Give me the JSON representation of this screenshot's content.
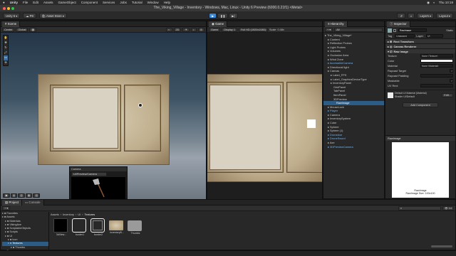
{
  "menubar": {
    "apple": "",
    "items": [
      "Unity",
      "File",
      "Edit",
      "Assets",
      "GameObject",
      "Component",
      "Services",
      "Jobs",
      "Tutorial",
      "Window",
      "Help"
    ],
    "status": [
      "◉",
      "◐",
      "Thu 10:19"
    ]
  },
  "window": {
    "title": "The_Viking_Village - Inventory - Windows, Mac, Linux - Unity 6 Preview (6000.0.21f1) <Metal>"
  },
  "toolbar": {
    "account": "Unity 6",
    "cloud_label": "P8",
    "asset_store": "Asset Store",
    "layers": "Layers",
    "layout": "Layout"
  },
  "scene": {
    "tab": "Scene",
    "tools": [
      "Center",
      "Global"
    ],
    "camera_panel": {
      "title": "Camera",
      "dropdown": "UI/Preview/Camera"
    }
  },
  "game": {
    "tab": "Game",
    "display": "Game",
    "display_select": "Display 1",
    "resolution": "Full HD (1920x1080)",
    "scale_label": "Scale",
    "scale_value": "0.48x",
    "play_focused": "Play Focused"
  },
  "hierarchy": {
    "tab": "Hierarchy",
    "search_placeholder": "All",
    "rows": [
      {
        "label": "The_Viking_Village*",
        "indent": 0,
        "cls": ""
      },
      {
        "label": "Content",
        "indent": 1,
        "cls": ""
      },
      {
        "label": "Reflection Probes",
        "indent": 1,
        "cls": ""
      },
      {
        "label": "Light Probes",
        "indent": 1,
        "cls": ""
      },
      {
        "label": "Volumes",
        "indent": 1,
        "cls": ""
      },
      {
        "label": "Occlusion Area",
        "indent": 1,
        "cls": ""
      },
      {
        "label": "Wind Zone",
        "indent": 1,
        "cls": ""
      },
      {
        "label": "AccessibleCamera",
        "indent": 1,
        "cls": "blue"
      },
      {
        "label": "Directional light",
        "indent": 1,
        "cls": ""
      },
      {
        "label": "Canvas",
        "indent": 1,
        "cls": ""
      },
      {
        "label": "Label_FPS",
        "indent": 2,
        "cls": ""
      },
      {
        "label": "Label_GraphicsDeviceType",
        "indent": 2,
        "cls": ""
      },
      {
        "label": "InventoryPanel",
        "indent": 2,
        "cls": ""
      },
      {
        "label": "GridPanel",
        "indent": 3,
        "cls": ""
      },
      {
        "label": "TabPanel",
        "indent": 3,
        "cls": ""
      },
      {
        "label": "ItemPanel",
        "indent": 3,
        "cls": ""
      },
      {
        "label": "3DPreview",
        "indent": 3,
        "cls": ""
      },
      {
        "label": "RawImage",
        "indent": 4,
        "cls": "sel"
      },
      {
        "label": "MouseLock",
        "indent": 1,
        "cls": ""
      },
      {
        "label": "Player",
        "indent": 1,
        "cls": "blue"
      },
      {
        "label": "Camera",
        "indent": 1,
        "cls": ""
      },
      {
        "label": "InventorySystem",
        "indent": 1,
        "cls": ""
      },
      {
        "label": "Cube",
        "indent": 1,
        "cls": ""
      },
      {
        "label": "Sphere",
        "indent": 1,
        "cls": ""
      },
      {
        "label": "Sphere (1)",
        "indent": 1,
        "cls": ""
      },
      {
        "label": "DroneAxe",
        "indent": 1,
        "cls": "blue"
      },
      {
        "label": "DroneSword",
        "indent": 1,
        "cls": "blue"
      },
      {
        "label": "Axe",
        "indent": 1,
        "cls": ""
      },
      {
        "label": "3DPreviewCamera",
        "indent": 1,
        "cls": "blue"
      }
    ]
  },
  "inspector": {
    "tab": "Inspector",
    "object_name": "RawImage",
    "static_label": "Static",
    "tag_label": "Tag",
    "tag_value": "Untagged",
    "layer_label": "Layer",
    "layer_value": "UI",
    "components": {
      "rect": "Rect Transform",
      "canvas_renderer": "Canvas Renderer",
      "raw_image": "Raw Image"
    },
    "fields": [
      {
        "label": "Texture",
        "value": "None (Texture)"
      },
      {
        "label": "Color",
        "value": ""
      },
      {
        "label": "Material",
        "value": "None (Material)"
      },
      {
        "label": "Raycast Target",
        "value": "✓"
      },
      {
        "label": "Raycast Padding",
        "value": ""
      },
      {
        "label": "Maskable",
        "value": "✓"
      },
      {
        "label": "UV Rect",
        "value": ""
      }
    ],
    "material_name": "Default UI Material (Material)",
    "shader_label": "Shader",
    "shader_value": "UI/Default",
    "edit_button": "Edit...",
    "add_component": "Add Component",
    "preview_title": "RawImage",
    "preview_caption": "RawImage\nRawImage Size: 100x100"
  },
  "project": {
    "tabs": [
      "Project",
      "Console"
    ],
    "breadcrumb": [
      "Assets",
      "Inventory",
      "UI",
      "Textures"
    ],
    "tree": [
      {
        "label": "Favorites",
        "indent": 0
      },
      {
        "label": "Assets",
        "indent": 0
      },
      {
        "label": "Materials",
        "indent": 1
      },
      {
        "label": "VikingAxe",
        "indent": 1
      },
      {
        "label": "ScriptableObjects",
        "indent": 1
      },
      {
        "label": "Scripts",
        "indent": 1
      },
      {
        "label": "UI",
        "indent": 1
      },
      {
        "label": "Icon",
        "indent": 2
      },
      {
        "label": "Textures",
        "indent": 2
      },
      {
        "label": "Thumbs",
        "indent": 3
      },
      {
        "label": "Scenes",
        "indent": 0
      }
    ],
    "assets": [
      {
        "label": "3dView...",
        "kind": "black"
      },
      {
        "label": "border1",
        "kind": "border"
      },
      {
        "label": "border2",
        "kind": "borderdot"
      },
      {
        "label": "inventoryB...",
        "kind": "parch"
      },
      {
        "label": "Thumbs",
        "kind": "folder"
      }
    ],
    "asset_count": "14"
  },
  "colors": {
    "selection": "#2c5d87",
    "hierarchy_blue": "#6db3f2",
    "play_blue": "#3b8ad9"
  }
}
